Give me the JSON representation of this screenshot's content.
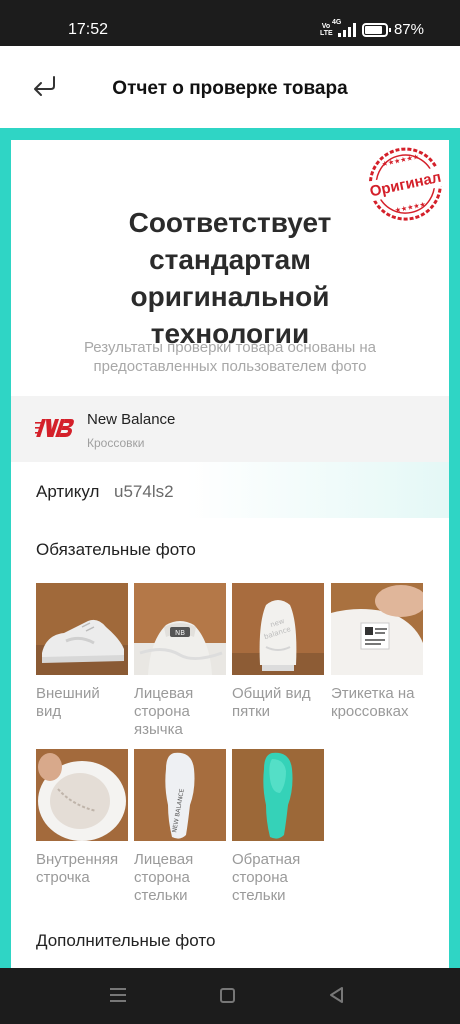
{
  "status": {
    "time": "17:52",
    "volte": "Vo LTE",
    "network": "4G",
    "battery": "87%",
    "battery_level": 0.87
  },
  "header": {
    "title": "Отчет о проверке товара",
    "back_icon": "back-arrow-icon"
  },
  "stamp": {
    "text": "Оригинал",
    "color": "#d4202a"
  },
  "result": {
    "headline_lines": [
      "Соответствует",
      "стандартам",
      "оригинальной",
      "технологии"
    ],
    "subtext": "Результаты проверки товара основаны на предоставленных пользователем фото"
  },
  "product": {
    "brand": "New Balance",
    "category": "Кроссовки",
    "brand_color": "#d4202a",
    "sku_label": "Артикул",
    "sku_value": "u574ls2"
  },
  "sections": {
    "required_title": "Обязательные фото",
    "extra_title": "Дополнительные фото"
  },
  "required_photos": [
    {
      "caption": "Внешний вид",
      "icon": "sneaker-side-photo"
    },
    {
      "caption": "Лицевая сторона язычка",
      "icon": "tongue-photo"
    },
    {
      "caption": "Общий вид пятки",
      "icon": "heel-photo"
    },
    {
      "caption": "Этикетка на кроссовках",
      "icon": "label-photo"
    },
    {
      "caption": "Внутренняя строчка",
      "icon": "inner-stitch-photo"
    },
    {
      "caption": "Лицевая сторона стельки",
      "icon": "insole-front-photo"
    },
    {
      "caption": "Обратная сторона стельки",
      "icon": "insole-back-photo"
    }
  ],
  "colors": {
    "accent": "#2fd5c5",
    "frame": "#2fd5c5"
  }
}
